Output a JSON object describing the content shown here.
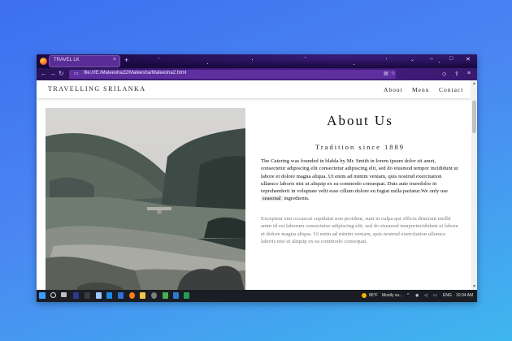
{
  "browser": {
    "tab_title": "TRAVEL LK",
    "tab_close": "×",
    "new_tab": "+",
    "url": "file:///E:/Maleesha22/Maleesha/Maleesha2.html"
  },
  "site": {
    "brand": "TRAVELLING SRILANKA",
    "nav": [
      "About",
      "Menu",
      "Contact"
    ],
    "heading": "About Us",
    "subheading": "Tradition since 1889",
    "para1_before": "The Catering was founded in blabla by Mr. Smith in lorem ipsum dolor sit amet, consectetur adipiscing elit consectetur adipiscing elit, sed do eiusmod tempor incididunt ut labore et dolore magna aliqua. Ut enim ad minim veniam, quis nostrud exercitation ullamco laboris nisi ut aliquip ex ea commodo consequat. Duis aute iruredolor in reprehenderit in voluptate velit esse cillum dolore eu fugiat nulla pariatur.We only use ",
    "para1_tag": "seasonal",
    "para1_after": " ingredients.",
    "para2": "Excepteur sint occaecat cupidatat non proident, sunt in culpa qui officia deserunt mollit anim id est laborum consectetur adipiscing elit, sed do eiusmod temporincididunt ut labore et dolore magna aliqua. Ut enim ad minim veniam, quis nostrud exercitation ullamco laboris nisi ut aliquip ex ea commodo consequat."
  },
  "taskbar": {
    "weather": "86°F",
    "weather_desc": "Mostly su...",
    "lang": "ENG",
    "time": "10:04 AM"
  },
  "colors": {
    "desktop": "#3d6ff0",
    "browser_chrome": "#2a1357",
    "taskbar": "#1b1d24"
  }
}
